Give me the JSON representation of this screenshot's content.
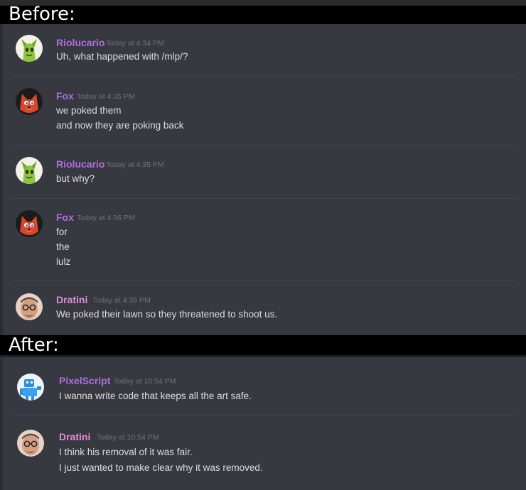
{
  "labels": {
    "before": "Before:",
    "after": "After:"
  },
  "colors": {
    "username_purple": "#b16ee0",
    "username_pink": "#e38dd8",
    "timestamp": "#6f737a",
    "message_text": "#dcddde",
    "panel_bg": "#36393f"
  },
  "before": {
    "messages": [
      {
        "author": "Riolucario",
        "timestamp": "Today at 4:34 PM",
        "avatar": "green-creature-avatar",
        "lines": [
          "Uh, what happened with /mlp/?"
        ]
      },
      {
        "author": "Fox",
        "timestamp": "Today at 4:35 PM",
        "avatar": "red-fox-avatar",
        "lines": [
          "we poked them",
          "and now they are poking back"
        ]
      },
      {
        "author": "Riolucario",
        "timestamp": "Today at 4:35 PM",
        "avatar": "green-creature-avatar",
        "lines": [
          "but why?"
        ]
      },
      {
        "author": "Fox",
        "timestamp": "Today at 4:36 PM",
        "avatar": "red-fox-avatar",
        "lines": [
          "for",
          "the",
          "lulz"
        ]
      },
      {
        "author": "Dratini",
        "timestamp": "Today at 4:36 PM",
        "avatar": "man-with-glasses-avatar",
        "lines": [
          "We poked their lawn so they threatened to shoot us."
        ]
      }
    ]
  },
  "after": {
    "messages": [
      {
        "author": "PixelScript",
        "timestamp": "Today at 10:54 PM",
        "avatar": "blue-robot-avatar",
        "lines": [
          "I wanna write code that keeps all the art safe."
        ]
      },
      {
        "author": "Dratini",
        "timestamp": "Today at 10:54 PM",
        "avatar": "man-with-glasses-avatar",
        "lines": [
          "I think his removal of it was fair.",
          "I just wanted to make clear why it was removed."
        ]
      }
    ]
  }
}
